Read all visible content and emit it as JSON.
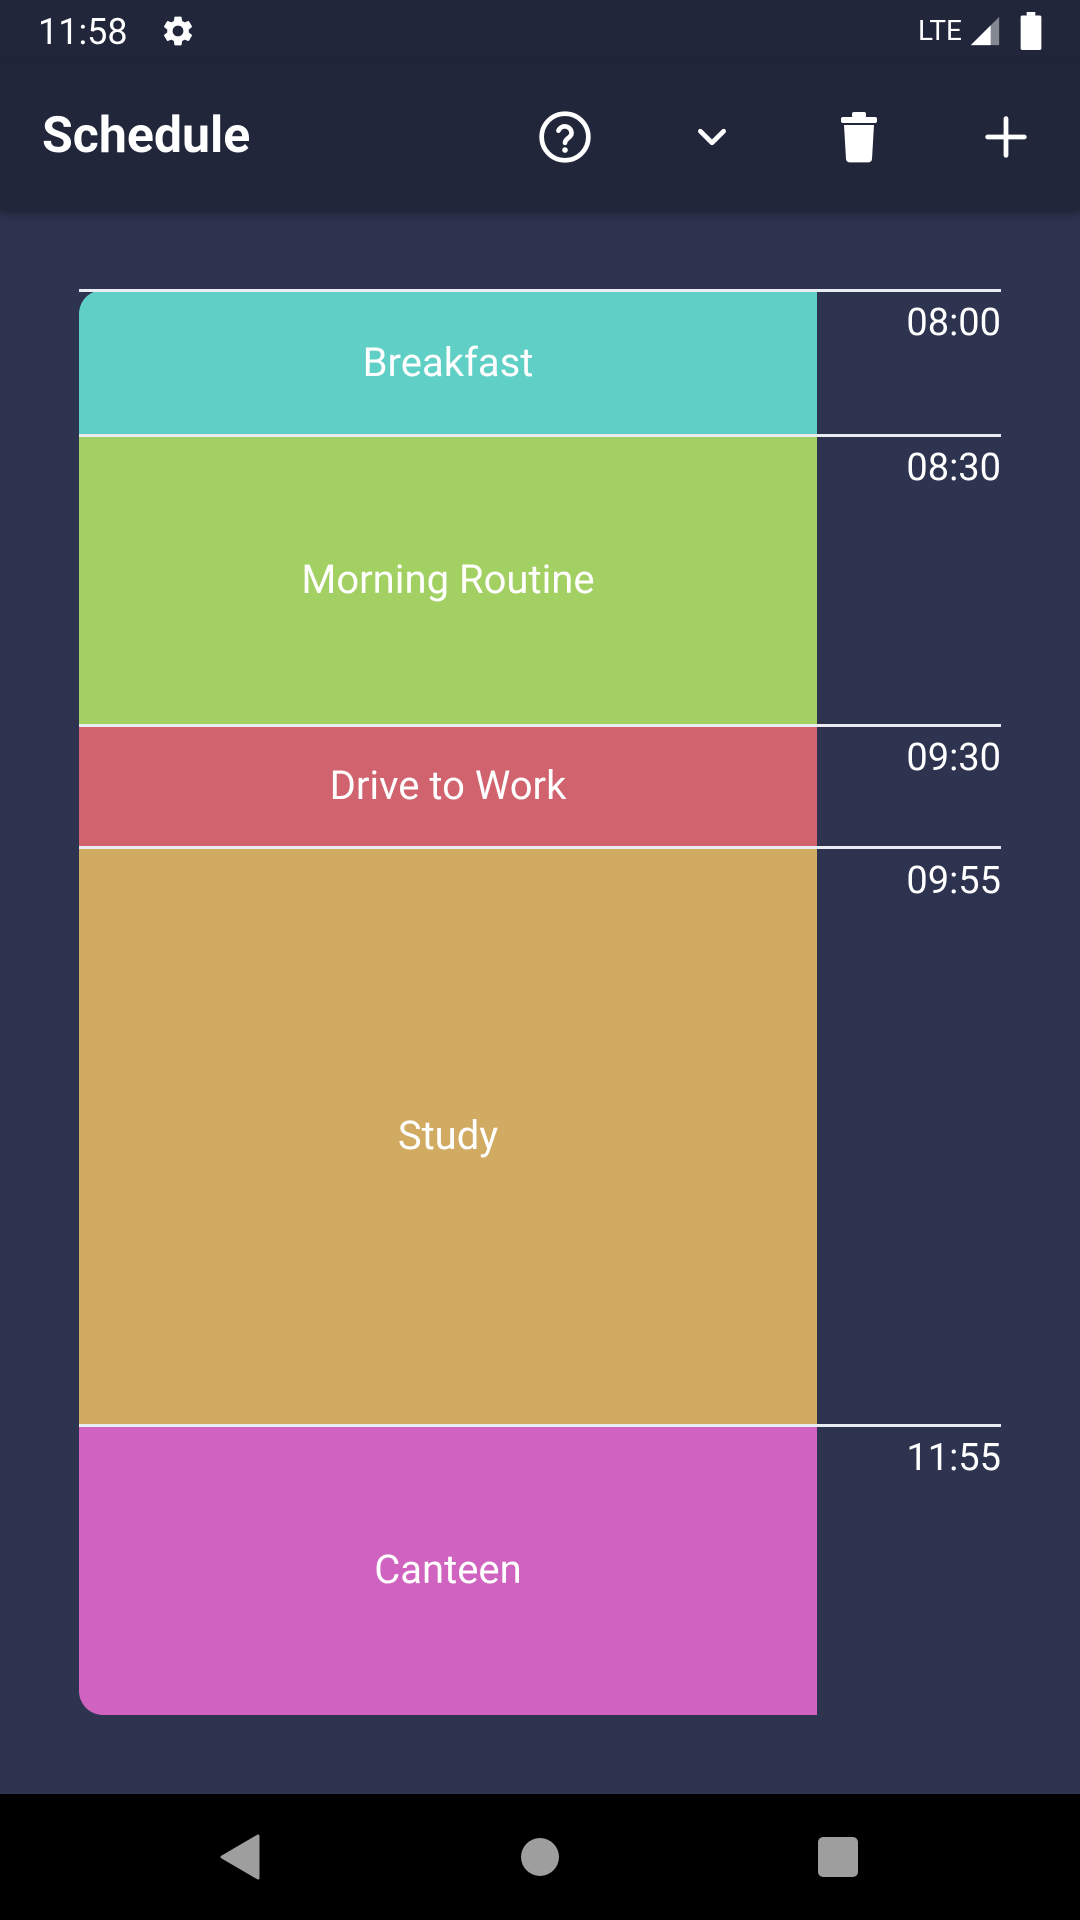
{
  "status_bar": {
    "time": "11:58",
    "network": "LTE"
  },
  "app_bar": {
    "title": "Schedule",
    "actions": {
      "help_icon": "help-circle-outline",
      "expand_icon": "chevron-down",
      "delete_icon": "trash-can",
      "add_icon": "plus"
    }
  },
  "schedule": {
    "blocks": [
      {
        "label": "Breakfast",
        "start": "08:00",
        "color": "#60d0c6"
      },
      {
        "label": "Morning Routine",
        "start": "08:30",
        "color": "#a3d062"
      },
      {
        "label": "Drive to Work",
        "start": "09:30",
        "color": "#d0636e"
      },
      {
        "label": "Study",
        "start": "09:55",
        "color": "#d1ab62"
      },
      {
        "label": "Canteen",
        "start": "11:55",
        "color": "#cf63bf"
      }
    ]
  },
  "colors": {
    "background": "#2e3450",
    "app_bar": "#21263a",
    "divider": "#e9ecf2",
    "nav_bar": "#000000",
    "nav_icon": "#9e9e9e"
  },
  "nav_bar": {
    "back_icon": "triangle-back",
    "home_icon": "circle-home",
    "recents_icon": "square-recents"
  }
}
